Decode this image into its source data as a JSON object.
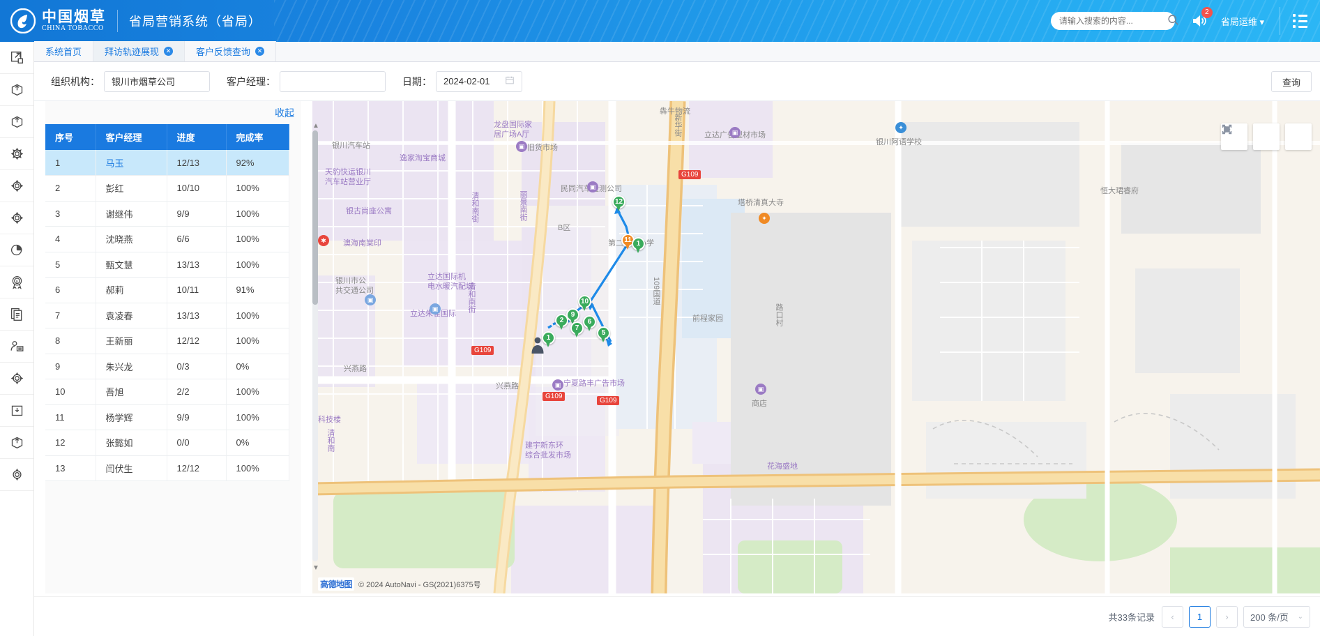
{
  "header": {
    "logo_cn": "中国烟草",
    "logo_en": "CHINA TOBACCO",
    "app_title": "省局营销系统（省局）",
    "search_placeholder": "请输入搜索的内容...",
    "search_value": "",
    "search_icon": "search-icon",
    "notification_icon": "speaker-icon",
    "notification_count": "2",
    "user_name": "省局运维",
    "user_caret": "▾",
    "menu_icon": "list-menu-icon"
  },
  "rail": {
    "items": [
      {
        "icon": "external-link-icon"
      },
      {
        "icon": "box-upload-icon"
      },
      {
        "icon": "box-upload-icon"
      },
      {
        "icon": "gear-icon"
      },
      {
        "icon": "gear-icon"
      },
      {
        "icon": "gear-icon"
      },
      {
        "icon": "pie-chart-icon"
      },
      {
        "icon": "registered-badge-icon"
      },
      {
        "icon": "document-copy-icon"
      },
      {
        "icon": "user-card-icon"
      },
      {
        "icon": "gear-icon"
      },
      {
        "icon": "archive-box-icon"
      },
      {
        "icon": "box-upload-icon"
      },
      {
        "icon": "gear-icon"
      }
    ]
  },
  "tabs": [
    {
      "label": "系统首页",
      "closable": false,
      "active": false
    },
    {
      "label": "拜访轨迹展现",
      "closable": true,
      "active": true,
      "close_glyph": "✕"
    },
    {
      "label": "客户反馈查询",
      "closable": true,
      "active": false,
      "close_glyph": "✕"
    }
  ],
  "filters": {
    "org_label": "组织机构：",
    "org_value": "银川市烟草公司",
    "manager_label": "客户经理：",
    "manager_value": "",
    "date_label": "日期：",
    "date_value": "2024-02-01",
    "date_icon": "calendar-icon",
    "query_button": "查询"
  },
  "panel": {
    "collapse_label": "收起",
    "columns": [
      "序号",
      "客户经理",
      "进度",
      "完成率"
    ],
    "rows": [
      {
        "no": "1",
        "manager": "马玉",
        "progress": "12/13",
        "rate": "92%",
        "selected": true
      },
      {
        "no": "2",
        "manager": "彭红",
        "progress": "10/10",
        "rate": "100%",
        "selected": false
      },
      {
        "no": "3",
        "manager": "谢继伟",
        "progress": "9/9",
        "rate": "100%",
        "selected": false
      },
      {
        "no": "4",
        "manager": "沈晓燕",
        "progress": "6/6",
        "rate": "100%",
        "selected": false
      },
      {
        "no": "5",
        "manager": "甄文慧",
        "progress": "13/13",
        "rate": "100%",
        "selected": false
      },
      {
        "no": "6",
        "manager": "郝莉",
        "progress": "10/11",
        "rate": "91%",
        "selected": false
      },
      {
        "no": "7",
        "manager": "袁凌春",
        "progress": "13/13",
        "rate": "100%",
        "selected": false
      },
      {
        "no": "8",
        "manager": "王新丽",
        "progress": "12/12",
        "rate": "100%",
        "selected": false
      },
      {
        "no": "9",
        "manager": "朱兴龙",
        "progress": "0/3",
        "rate": "0%",
        "selected": false
      },
      {
        "no": "10",
        "manager": "吾旭",
        "progress": "2/2",
        "rate": "100%",
        "selected": false
      },
      {
        "no": "11",
        "manager": "杨学辉",
        "progress": "9/9",
        "rate": "100%",
        "selected": false
      },
      {
        "no": "12",
        "manager": "张懿如",
        "progress": "0/0",
        "rate": "0%",
        "selected": false
      },
      {
        "no": "13",
        "manager": "闫伏生",
        "progress": "12/12",
        "rate": "100%",
        "selected": false
      }
    ]
  },
  "map": {
    "controls": [
      {
        "name": "fullscreen-button",
        "icon": "expand-icon"
      },
      {
        "name": "play-button",
        "icon": "play-icon"
      },
      {
        "name": "stop-button",
        "icon": "stop-icon"
      }
    ],
    "attribution": "© 2024 AutoNavi - GS(2021)6375号",
    "provider_logo": "高德地图",
    "markers": [
      {
        "label": "12",
        "color": "green"
      },
      {
        "label": "11",
        "color": "orange"
      },
      {
        "label": "1",
        "color": "green"
      },
      {
        "label": "10",
        "color": "green"
      },
      {
        "label": "9",
        "color": "green"
      },
      {
        "label": "2",
        "color": "green"
      },
      {
        "label": "6",
        "color": "green"
      },
      {
        "label": "7",
        "color": "green"
      },
      {
        "label": "5",
        "color": "green"
      },
      {
        "label": "1",
        "color": "green"
      }
    ],
    "pois": [
      {
        "text": "银川汽车站"
      },
      {
        "text": "龙盘国际家",
        "sub": "居广场A厅"
      },
      {
        "text": "犇牛物流"
      },
      {
        "text": "立达广告型材市场"
      },
      {
        "text": "银川阿语学校"
      },
      {
        "text": "逸家淘宝商城"
      },
      {
        "text": "旧货市场"
      },
      {
        "text": "天豹快运银川",
        "sub": "汽车站营业厅"
      },
      {
        "text": "民同汽车检测公司"
      },
      {
        "text": "恒大珺睿府"
      },
      {
        "text": "银古尚座公寓"
      },
      {
        "text": "塔桥清真大寺"
      },
      {
        "text": "丽景南街"
      },
      {
        "text": "B区"
      },
      {
        "text": "清和南街"
      },
      {
        "text": "澳海南棠印"
      },
      {
        "text": "立达国际机",
        "sub": "电水暖汽配城"
      },
      {
        "text": "银川市公",
        "sub": "共交通公司"
      },
      {
        "text": "109国道"
      },
      {
        "text": "前程家园"
      },
      {
        "text": "路口村"
      },
      {
        "text": "清和南街"
      },
      {
        "text": "立达朱雀国际"
      },
      {
        "text": "兴燕路"
      },
      {
        "text": "兴燕路"
      },
      {
        "text": "宁夏路丰广告市场"
      },
      {
        "text": "商店"
      },
      {
        "text": "建宇新东环",
        "sub": "综合批发市场"
      },
      {
        "text": "花海盛地"
      },
      {
        "text": "科技楼"
      },
      {
        "text": "清和南"
      },
      {
        "text": "第二十一小学"
      },
      {
        "text": "新华街"
      },
      {
        "text": "G109"
      }
    ]
  },
  "footer": {
    "total_text": "共33条记录",
    "prev_glyph": "‹",
    "next_glyph": "›",
    "current_page": "1",
    "page_size": "200 条/页",
    "caret": "⌄"
  }
}
